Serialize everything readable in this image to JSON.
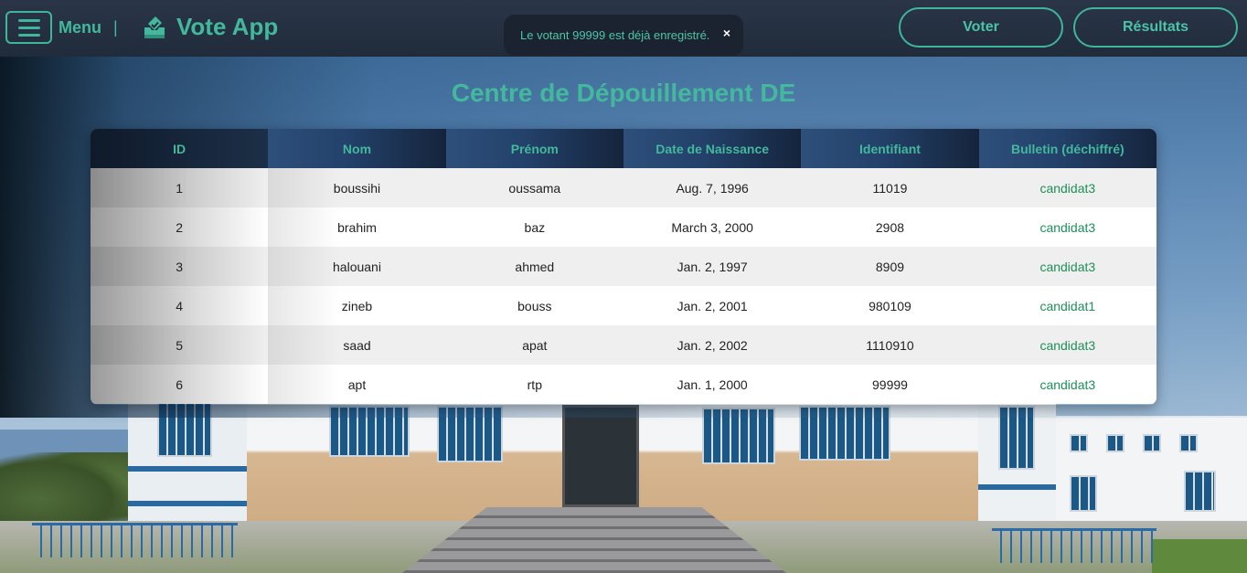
{
  "navbar": {
    "menu_label": "Menu",
    "separator": "|",
    "app_title": "Vote App",
    "voter_label": "Voter",
    "results_label": "Résultats"
  },
  "toast": {
    "message": "Le votant 99999 est déjà enregistré.",
    "close_glyph": "×"
  },
  "page_title": "Centre de Dépouillement DE",
  "table": {
    "headers": [
      "ID",
      "Nom",
      "Prénom",
      "Date de Naissance",
      "Identifiant",
      "Bulletin (déchiffré)"
    ],
    "rows": [
      [
        "1",
        "boussihi",
        "oussama",
        "Aug. 7, 1996",
        "11019",
        "candidat3"
      ],
      [
        "2",
        "brahim",
        "baz",
        "March 3, 2000",
        "2908",
        "candidat3"
      ],
      [
        "3",
        "halouani",
        "ahmed",
        "Jan. 2, 1997",
        "8909",
        "candidat3"
      ],
      [
        "4",
        "zineb",
        "bouss",
        "Jan. 2, 2001",
        "980109",
        "candidat1"
      ],
      [
        "5",
        "saad",
        "apat",
        "Jan. 2, 2002",
        "1110910",
        "candidat3"
      ],
      [
        "6",
        "apt",
        "rtp",
        "Jan. 1, 2000",
        "99999",
        "candidat3"
      ]
    ]
  },
  "colors": {
    "accent": "#43b89c",
    "navbar": "#202b3b",
    "bulletin_text": "#1f8f5a"
  },
  "icons": {
    "menu": "hamburger-icon",
    "brand": "ballot-box-icon",
    "close": "close-icon"
  }
}
